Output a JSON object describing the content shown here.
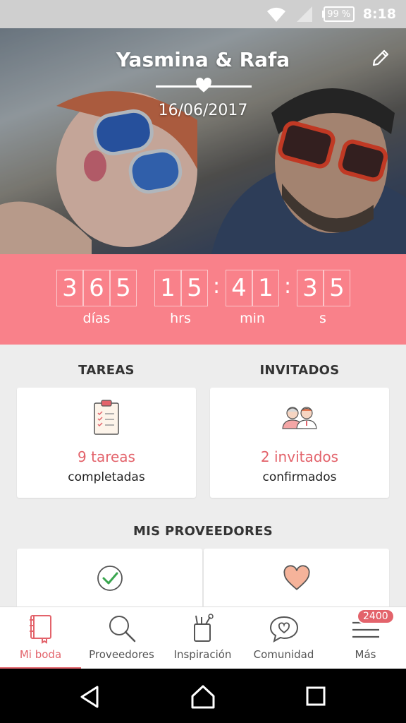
{
  "status_bar": {
    "battery": "99 %",
    "time": "8:18"
  },
  "hero": {
    "couple": "Yasmina & Rafa",
    "date": "16/06/2017"
  },
  "countdown": {
    "days": [
      "3",
      "6",
      "5"
    ],
    "hours": [
      "1",
      "5"
    ],
    "minutes": [
      "4",
      "1"
    ],
    "seconds": [
      "3",
      "5"
    ],
    "labels": {
      "days": "días",
      "hours": "hrs",
      "minutes": "min",
      "seconds": "s"
    }
  },
  "tasks": {
    "title": "TAREAS",
    "count": "9 tareas",
    "sub": "completadas"
  },
  "guests": {
    "title": "INVITADOS",
    "count": "2 invitados",
    "sub": "confirmados"
  },
  "vendors": {
    "title": "MIS PROVEEDORES"
  },
  "nav": {
    "items": [
      {
        "label": "Mi boda",
        "icon": "notebook-icon"
      },
      {
        "label": "Proveedores",
        "icon": "search-icon"
      },
      {
        "label": "Inspiración",
        "icon": "inspiration-icon"
      },
      {
        "label": "Comunidad",
        "icon": "chat-heart-icon"
      },
      {
        "label": "Más",
        "icon": "menu-icon"
      }
    ],
    "badge": "2400"
  },
  "colors": {
    "accent": "#f9818a",
    "accent_text": "#e3636b"
  }
}
